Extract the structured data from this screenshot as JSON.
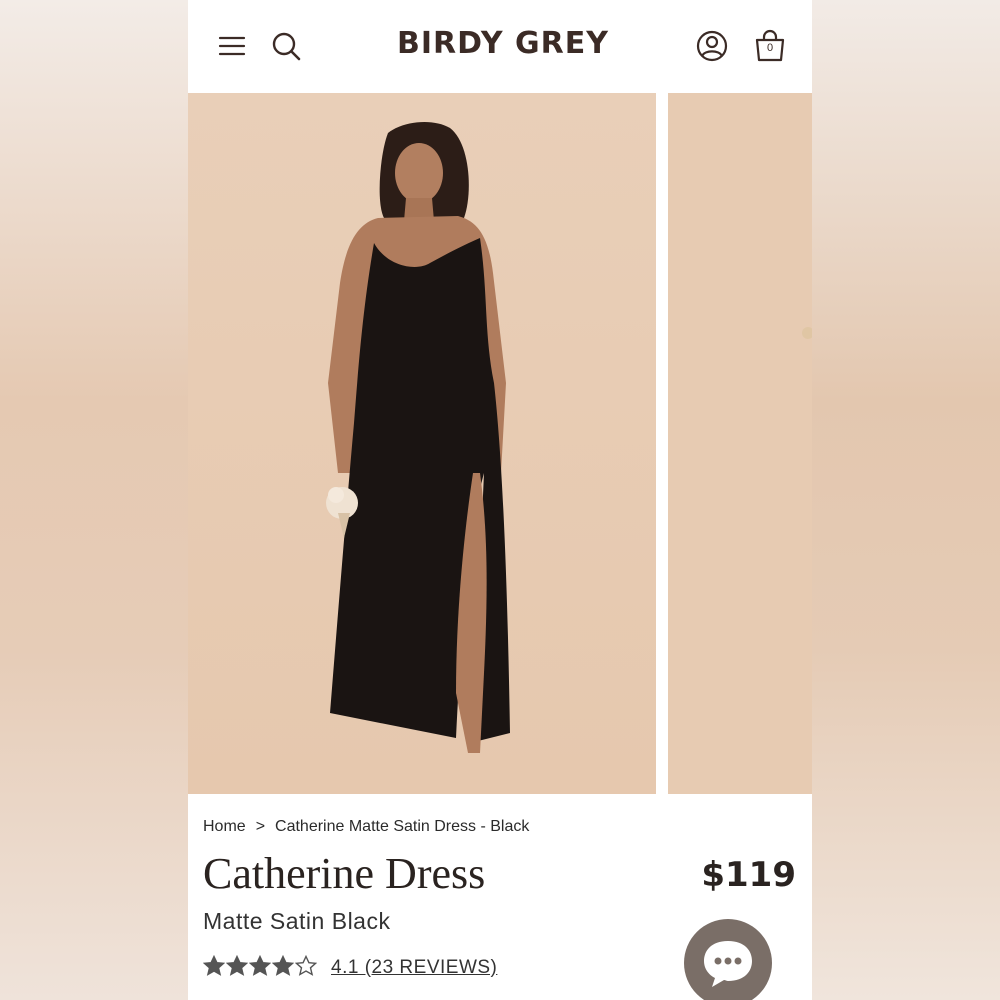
{
  "brand": "BIRDY GREY",
  "header": {
    "menu_icon": "hamburger-menu-icon",
    "search_icon": "search-icon",
    "account_icon": "account-icon",
    "bag_icon": "shopping-bag-icon",
    "bag_count": "0"
  },
  "breadcrumb": {
    "home": "Home",
    "separator": ">",
    "current": "Catherine Matte Satin Dress - Black"
  },
  "product": {
    "name": "Catherine Dress",
    "variant": "Matte Satin Black",
    "price": "$119",
    "rating_value": 4.1,
    "rating_max": 5,
    "rating_text": "4.1 (23 REVIEWS)"
  },
  "chat": {
    "icon": "chat-bubble-icon"
  },
  "colors": {
    "brand_text": "#3b2b26",
    "photo_background": "#e8cdb5",
    "dress": "#1a1412",
    "star": "#555555",
    "chat_button": "#7a6e67"
  }
}
